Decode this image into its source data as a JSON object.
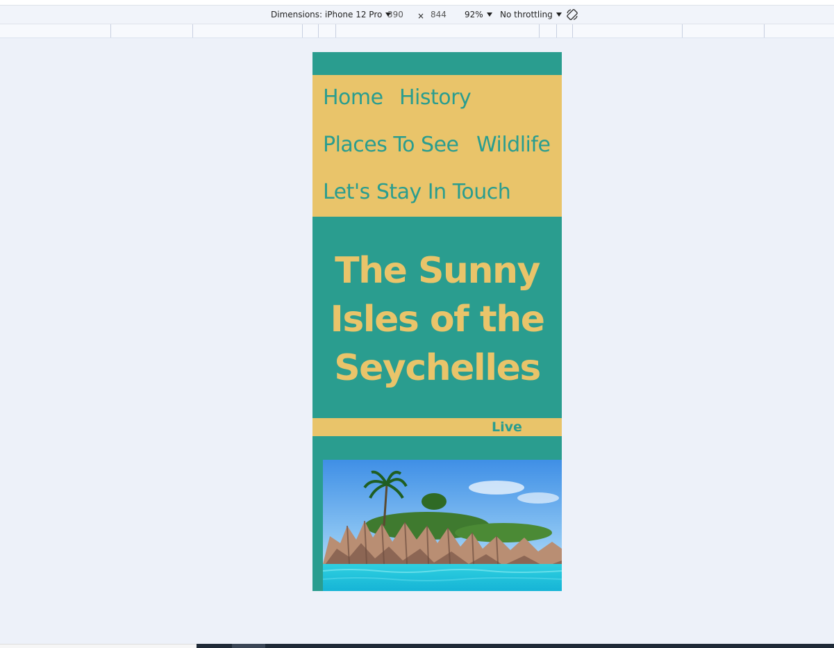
{
  "device_toolbar": {
    "dimensions_label": "Dimensions: iPhone 12 Pro",
    "width_value": "390",
    "times_symbol": "×",
    "height_value": "844",
    "zoom_label": "92%",
    "throttling_label": "No throttling",
    "rotate_icon": "rotate-icon"
  },
  "page": {
    "nav": {
      "items": [
        {
          "label": "Home"
        },
        {
          "label": "History"
        },
        {
          "label": "Places To See"
        },
        {
          "label": "Wildlife"
        },
        {
          "label": "Let's Stay In Touch"
        }
      ]
    },
    "hero": {
      "title_line1": "The Sunny",
      "title_line2": "Isles of the",
      "title_line3": "Seychelles"
    },
    "live_label": "Live",
    "colors": {
      "teal": "#2a9d8f",
      "gold": "#e9c46a"
    }
  }
}
